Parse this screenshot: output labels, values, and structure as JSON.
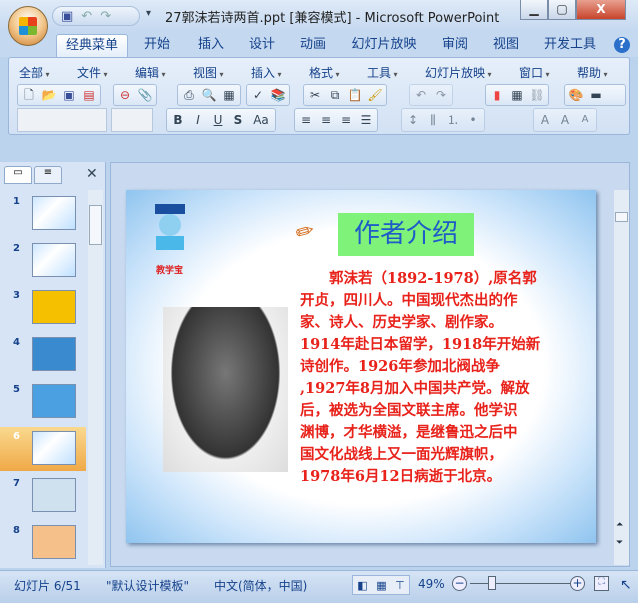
{
  "window": {
    "title": "27郭沫若诗两首.ppt [兼容模式] - Microsoft PowerPoint",
    "minimize": "▁",
    "maximize": "▢",
    "close": "X"
  },
  "tabs": [
    "经典菜单",
    "开始",
    "插入",
    "设计",
    "动画",
    "幻灯片放映",
    "审阅",
    "视图",
    "开发工具"
  ],
  "help": "?",
  "menus": [
    "全部",
    "文件",
    "编辑",
    "视图",
    "插入",
    "格式",
    "工具",
    "幻灯片放映",
    "窗口",
    "帮助"
  ],
  "format_buttons": [
    "B",
    "I",
    "U",
    "S",
    "Aa"
  ],
  "panel": {
    "thumbs": [
      "1",
      "2",
      "3",
      "4",
      "5",
      "6",
      "7",
      "8"
    ],
    "selected": 6
  },
  "slide": {
    "logo_text": "教学宝",
    "title": "作者介绍",
    "body_lines": [
      "　　郭沫若（1892-1978）,原名郭",
      "开贞，四川人。中国现代杰出的作",
      "家、诗人、历史学家、剧作家。",
      "1914年赴日本留学，1918年开始新",
      "诗创作。1926年参加北阀战争",
      ",1927年8月加入中国共产党。解放",
      "后，被选为全国文联主席。他学识",
      "渊博，才华横溢，是继鲁迅之后中",
      "国文化战线上又一面光辉旗帜，",
      "1978年6月12日病逝于北京。"
    ]
  },
  "status": {
    "slide": "幻灯片 6/51",
    "template": "\"默认设计模板\"",
    "language": "中文(简体，中国)",
    "zoom": "49%",
    "zoom_value": 49
  }
}
